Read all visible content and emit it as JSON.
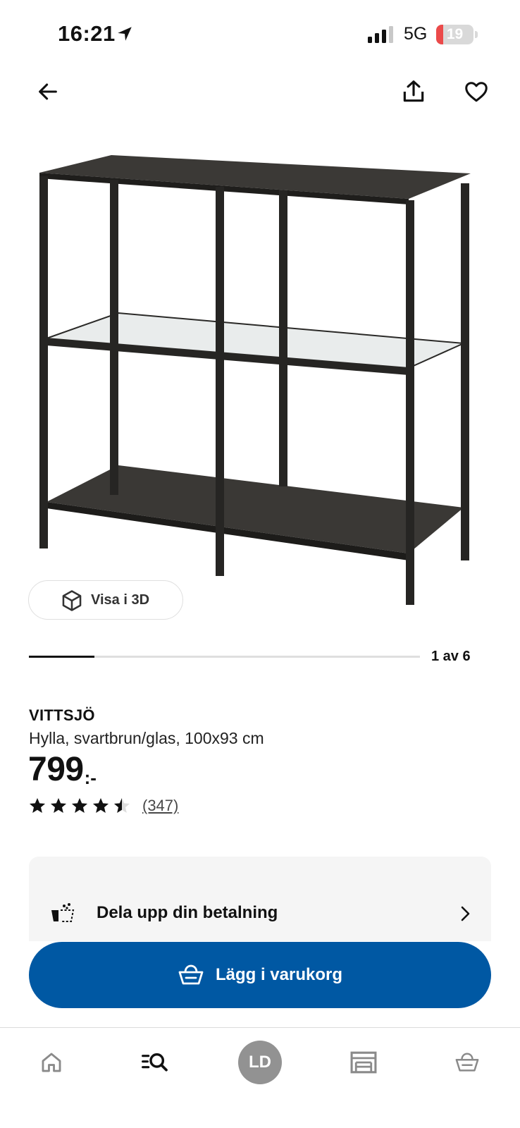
{
  "status_bar": {
    "time": "16:21",
    "network": "5G",
    "battery_level": "19",
    "battery_fraction": 0.19,
    "battery_color": "#eb4a4a"
  },
  "header": {
    "back_icon": "arrow-left-icon",
    "share_icon": "share-icon",
    "favorite_icon": "heart-icon"
  },
  "gallery": {
    "view_3d_label": "Visa i 3D",
    "counter": "1 av 6",
    "current_index": 1,
    "total": 6
  },
  "product": {
    "name": "VITTSJÖ",
    "description": "Hylla, svartbrun/glas, 100x93 cm",
    "price": "799",
    "price_suffix": ":-",
    "rating": 4.5,
    "review_count": "(347)"
  },
  "payment": {
    "label": "Dela upp din betalning",
    "icon": "split-payment-icon"
  },
  "cart_button": {
    "label": "Lägg i varukorg",
    "icon": "basket-icon",
    "color": "#0058a3"
  },
  "tab_bar": {
    "items": [
      {
        "icon": "home-icon"
      },
      {
        "icon": "search-icon"
      },
      {
        "icon": "profile-avatar",
        "initials": "LD"
      },
      {
        "icon": "store-icon"
      },
      {
        "icon": "basket-icon"
      }
    ],
    "selected": "search"
  }
}
